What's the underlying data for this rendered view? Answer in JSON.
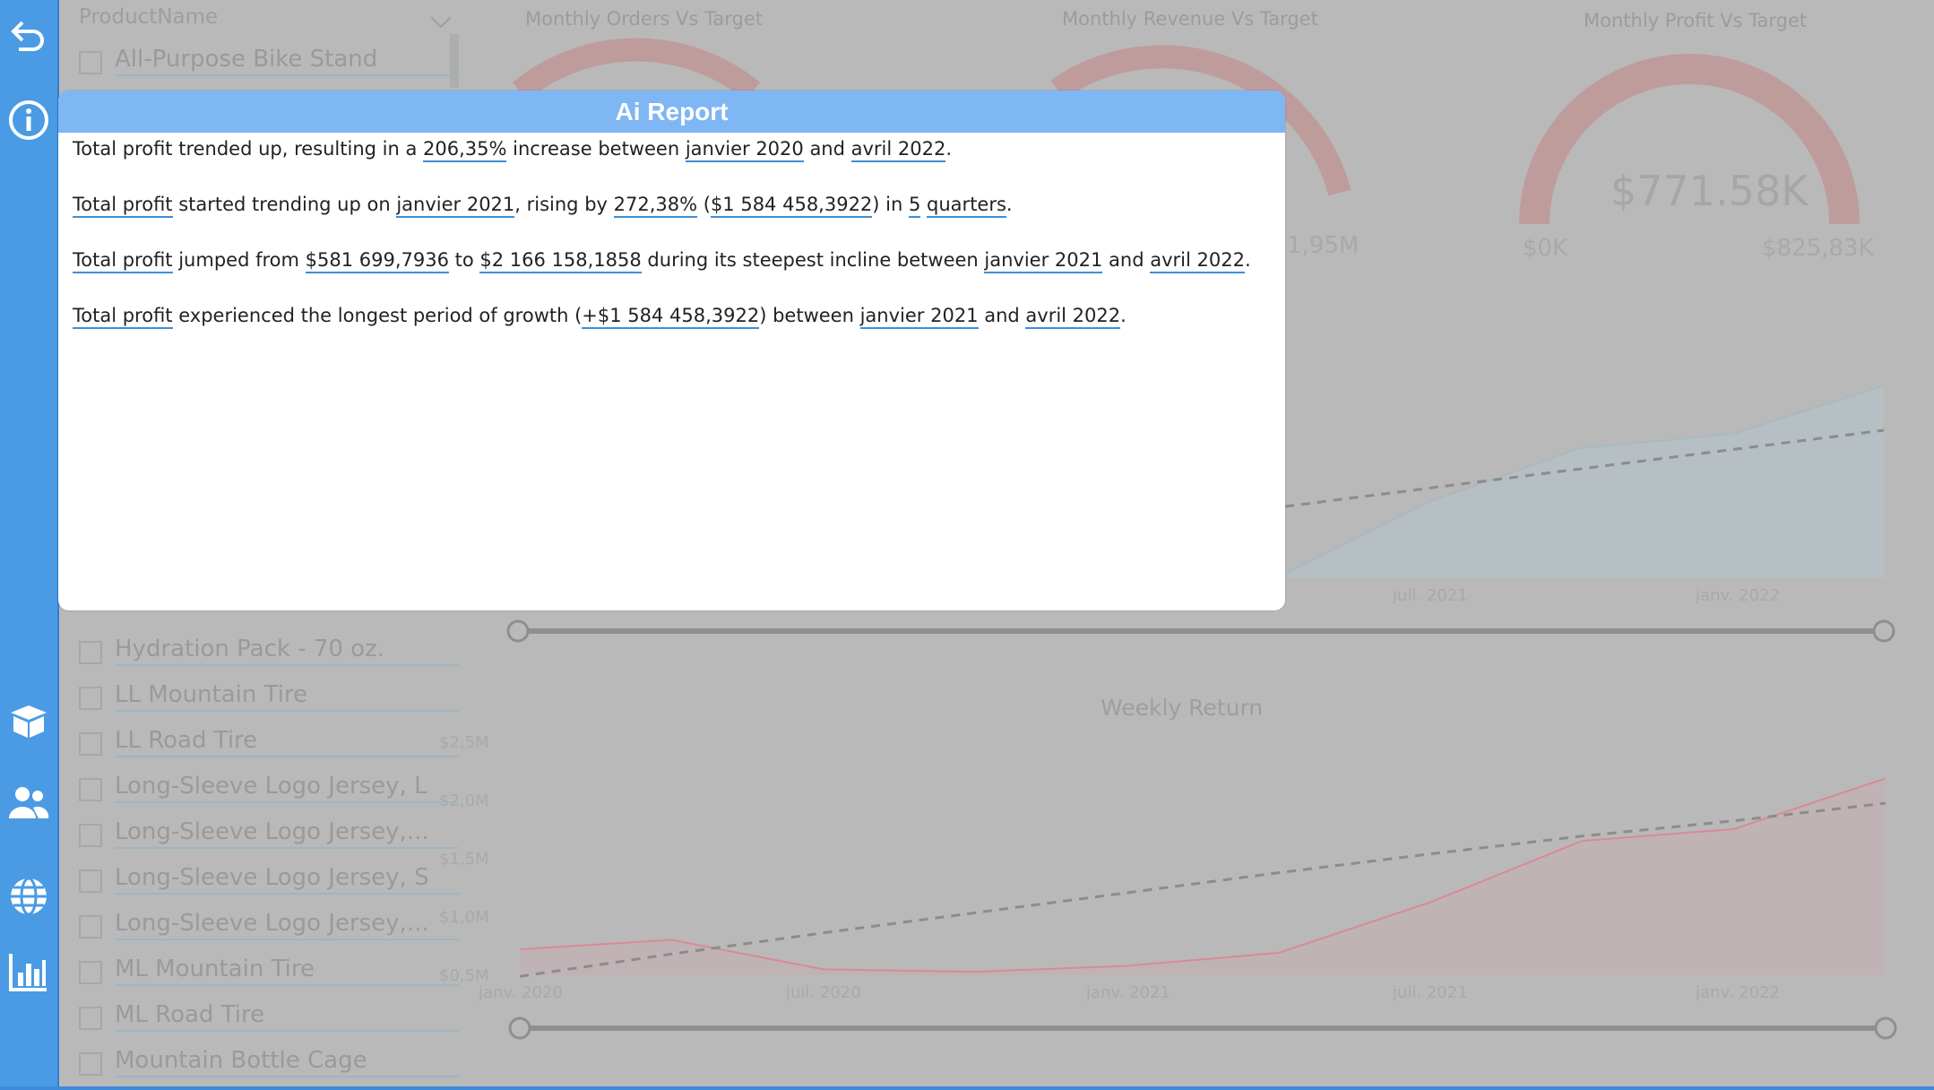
{
  "nav": {
    "items": [
      "back-arrow-icon",
      "info-icon",
      "package-icon",
      "users-icon",
      "globe-icon",
      "bar-chart-icon"
    ]
  },
  "slicer": {
    "header": "ProductName",
    "items_top": [
      "All-Purpose Bike Stand"
    ],
    "items_bottom": [
      "Hydration Pack - 70 oz.",
      "LL Mountain Tire",
      "LL Road Tire",
      "Long-Sleeve Logo Jersey, L",
      "Long-Sleeve Logo Jersey,...",
      "Long-Sleeve Logo Jersey, S",
      "Long-Sleeve Logo Jersey,...",
      "ML Mountain Tire",
      "ML Road Tire",
      "Mountain Bottle Cage"
    ]
  },
  "gauges": {
    "orders_title": "Monthly Orders Vs Target",
    "revenue_title": "Monthly Revenue Vs Target",
    "revenue_max_partial": "1,95M",
    "profit_title": "Monthly Profit Vs Target",
    "profit_value": "$771.58K",
    "profit_min": "$0K",
    "profit_max": "$825,83K"
  },
  "top_chart": {
    "x_labels": [
      "juil. 2021",
      "janv. 2022"
    ]
  },
  "weekly_return": {
    "title": "Weekly Return",
    "y_labels": [
      "$2,5M",
      "$2,0M",
      "$1,5M",
      "$1,0M",
      "$0,5M"
    ],
    "x_labels": [
      "janv. 2020",
      "juil. 2020",
      "janv. 2021",
      "juil. 2021",
      "janv. 2022"
    ]
  },
  "chart_data": {
    "type": "line",
    "title": "Weekly Return",
    "x": [
      "janv. 2020",
      "avr. 2020",
      "juil. 2020",
      "oct. 2020",
      "janv. 2021",
      "avr. 2021",
      "juil. 2021",
      "oct. 2021",
      "janv. 2022",
      "avr. 2022"
    ],
    "series": [
      {
        "values": [
          0.72,
          0.8,
          0.55,
          0.53,
          0.58,
          0.69,
          1.12,
          1.64,
          1.74,
          2.17
        ]
      }
    ],
    "trend": [
      0.49,
      0.68,
      0.86,
      1.03,
      1.2,
      1.37,
      1.53,
      1.68,
      1.81,
      1.96
    ],
    "ylim": [
      0.5,
      2.5
    ],
    "colors": {
      "line": "#d98a96",
      "trend": "#8c8c8c"
    }
  },
  "modal": {
    "title": "Ai Report",
    "p1": {
      "t1": "Total profit trended up, resulting in a ",
      "h1": "206,35%",
      "t2": " increase between ",
      "h2": "janvier 2020",
      "t3": " and ",
      "h3": "avril 2022",
      "t4": "."
    },
    "p2": {
      "h1": "Total profit",
      "t1": " started trending up on ",
      "h2": "janvier 2021",
      "t2": ", rising by ",
      "h3": "272,38%",
      "t3": " (",
      "h4": "$1 584 458,3922",
      "t4": ") in ",
      "h5": "5",
      "t5": " ",
      "h6": "quarters",
      "t6": "."
    },
    "p3": {
      "h1": "Total profit",
      "t1": " jumped from ",
      "h2": "$581 699,7936",
      "t2": " to ",
      "h3": "$2 166 158,1858",
      "t3": " during its steepest incline between ",
      "h4": "janvier 2021",
      "t4": " and ",
      "h5": "avril 2022",
      "t5": "."
    },
    "p4": {
      "h1": "Total profit",
      "t1": " experienced the longest period of growth (",
      "h2": "+$1 584 458,3922",
      "t2": ") between ",
      "h3": "janvier 2021",
      "t3": " and ",
      "h4": "avril 2022",
      "t4": "."
    }
  }
}
